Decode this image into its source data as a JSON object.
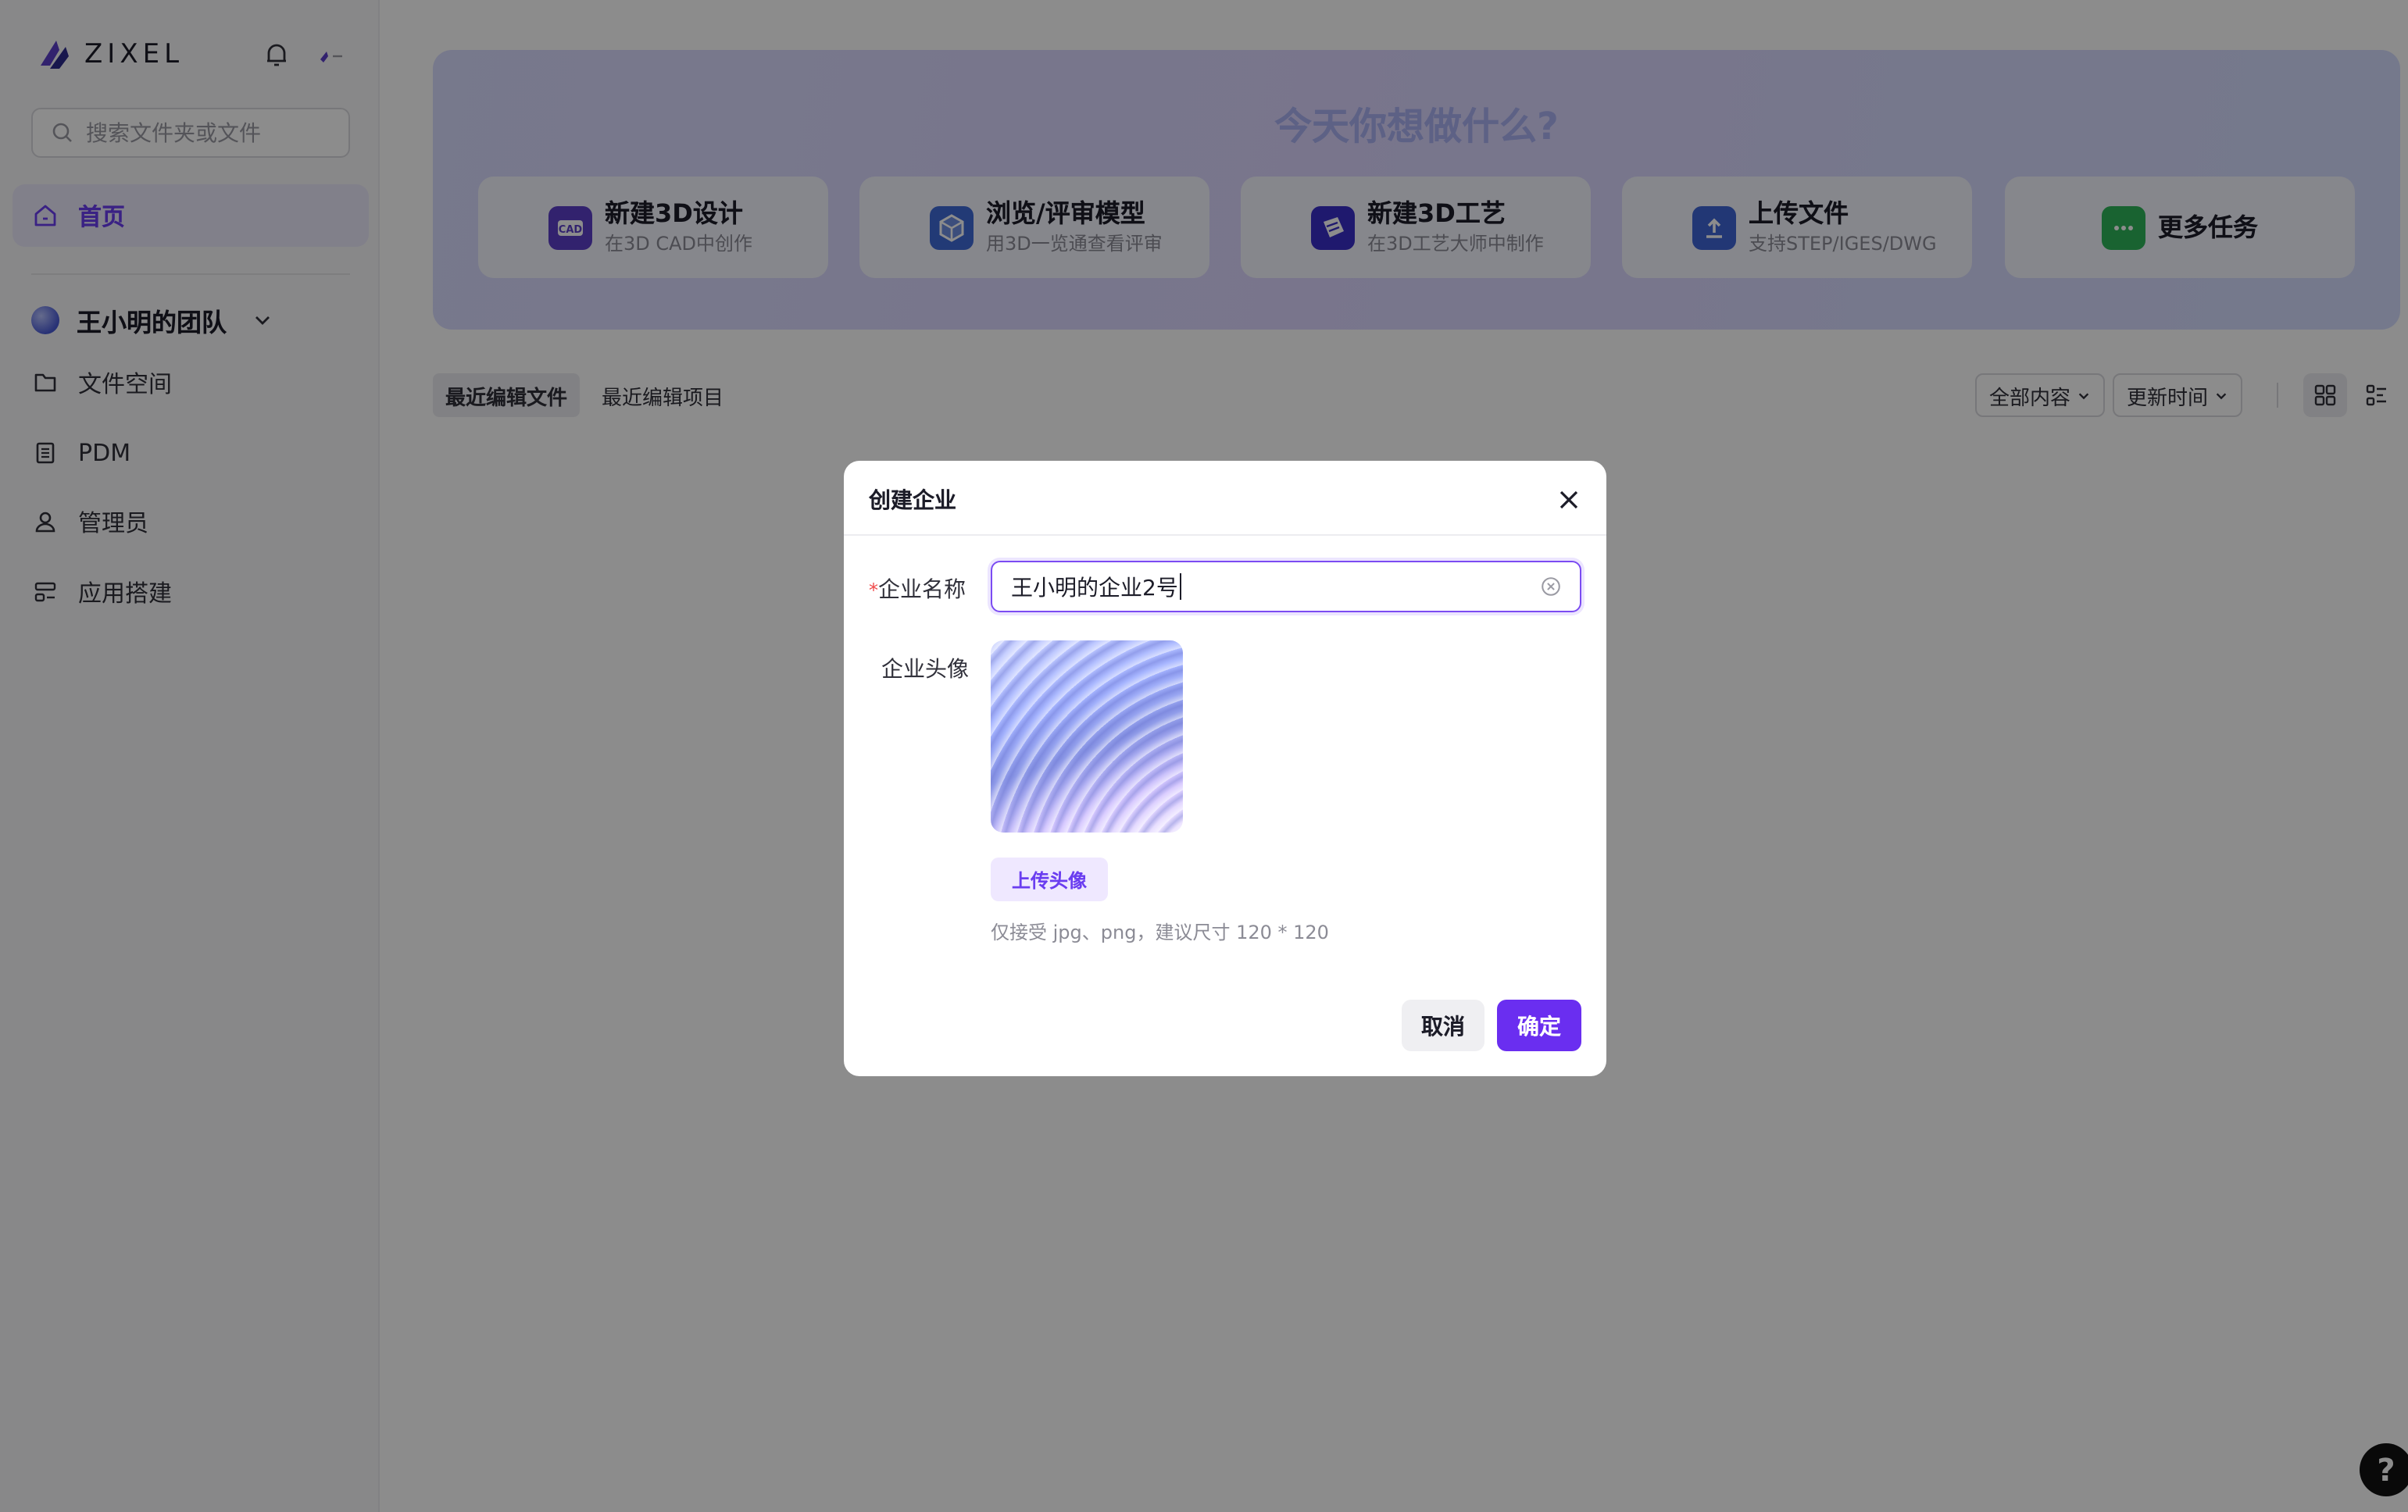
{
  "brand": {
    "name": "ZIXEL",
    "accent": "#6a3df0"
  },
  "sidebar": {
    "search_placeholder": "搜索文件夹或文件",
    "home_label": "首页",
    "team_name": "王小明的团队",
    "items": [
      {
        "label": "文件空间",
        "icon": "folder-icon"
      },
      {
        "label": "PDM",
        "icon": "document-icon"
      },
      {
        "label": "管理员",
        "icon": "user-icon"
      },
      {
        "label": "应用搭建",
        "icon": "app-build-icon"
      }
    ]
  },
  "hero": {
    "title": "今天你想做什么?",
    "tasks": [
      {
        "title": "新建3D设计",
        "subtitle": "在3D CAD中创作",
        "icon": "cad-icon",
        "color": "#5b3ec8"
      },
      {
        "title": "浏览/评审模型",
        "subtitle": "用3D一览通查看评审",
        "icon": "cube-icon",
        "color": "#3e6ad8"
      },
      {
        "title": "新建3D工艺",
        "subtitle": "在3D工艺大师中制作",
        "icon": "book-icon",
        "color": "#3a2fc8"
      },
      {
        "title": "上传文件",
        "subtitle": "支持STEP/IGES/DWG",
        "icon": "upload-icon",
        "color": "#3f64d6"
      },
      {
        "title": "更多任务",
        "subtitle": "",
        "icon": "more-icon",
        "color": "#2fb559"
      }
    ]
  },
  "tabs": [
    {
      "label": "最近编辑文件",
      "active": true
    },
    {
      "label": "最近编辑项目",
      "active": false
    }
  ],
  "filters": {
    "content": "全部内容",
    "sort": "更新时间"
  },
  "help": {
    "label": "?"
  },
  "modal": {
    "title": "创建企业",
    "name_label": "企业名称",
    "required_mark": "*",
    "name_value": "王小明的企业2号",
    "avatar_label": "企业头像",
    "upload_label": "上传头像",
    "hint": "仅接受 jpg、png，建议尺寸 120 * 120",
    "cancel_label": "取消",
    "confirm_label": "确定"
  }
}
